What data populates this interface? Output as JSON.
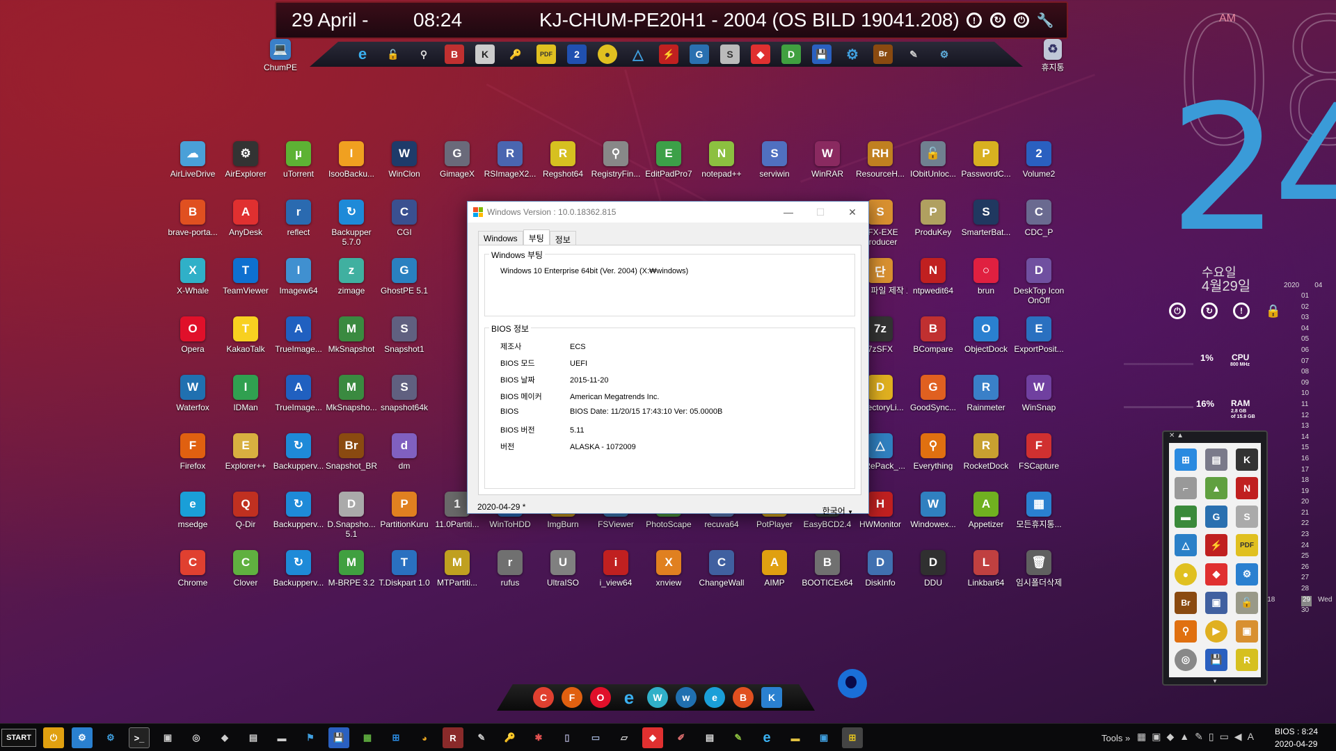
{
  "topbar": {
    "date": "29 April -",
    "time": "08:24",
    "title": "KJ-CHUM-PE20H1 - 2004 (OS BILD 19041.208)"
  },
  "desktop_top": {
    "chumpe": "ChumPE",
    "trash": "휴지통"
  },
  "desktop_icons": [
    {
      "label": "AirLiveDrive",
      "color": "#4aa0d8",
      "glyph": "☁"
    },
    {
      "label": "AirExplorer",
      "color": "#333",
      "glyph": "⚙"
    },
    {
      "label": "uTorrent",
      "color": "#5db234",
      "glyph": "µ"
    },
    {
      "label": "IsooBacku...",
      "color": "#f0a020",
      "glyph": "I"
    },
    {
      "label": "WinClon",
      "color": "#1e3b6a",
      "glyph": "W"
    },
    {
      "label": "GimageX",
      "color": "#6a6a7a",
      "glyph": "G"
    },
    {
      "label": "RSImageX2...",
      "color": "#4a66b0",
      "glyph": "R"
    },
    {
      "label": "Regshot64",
      "color": "#d6c020",
      "glyph": "R"
    },
    {
      "label": "RegistryFin...",
      "color": "#888",
      "glyph": "⚲"
    },
    {
      "label": "EditPadPro7",
      "color": "#3ca048",
      "glyph": "E"
    },
    {
      "label": "notepad++",
      "color": "#8cc040",
      "glyph": "N"
    },
    {
      "label": "serviwin",
      "color": "#5070c0",
      "glyph": "S"
    },
    {
      "label": "WinRAR",
      "color": "#8a2a60",
      "glyph": "W"
    },
    {
      "label": "ResourceH...",
      "color": "#c08020",
      "glyph": "RH"
    },
    {
      "label": "IObitUnloc...",
      "color": "#708090",
      "glyph": "🔓"
    },
    {
      "label": "PasswordC...",
      "color": "#d8b020",
      "glyph": "P"
    },
    {
      "label": "Volume2",
      "color": "#2a60c0",
      "glyph": "2"
    },
    {
      "label": "brave-porta...",
      "color": "#e05020",
      "glyph": "B"
    },
    {
      "label": "AnyDesk",
      "color": "#e03030",
      "glyph": "A"
    },
    {
      "label": "reflect",
      "color": "#2a6ab0",
      "glyph": "r"
    },
    {
      "label": "Backupper 5.7.0",
      "color": "#1e8ad8",
      "glyph": "↻"
    },
    {
      "label": "CGI",
      "color": "#3a5090",
      "glyph": "C"
    },
    {
      "label": "SFX-EXE Producer",
      "color": "#d89030",
      "glyph": "S"
    },
    {
      "label": "ProduKey",
      "color": "#b0a060",
      "glyph": "P"
    },
    {
      "label": "SmarterBat...",
      "color": "#203860",
      "glyph": "S"
    },
    {
      "label": "CDC_P",
      "color": "#6a6a90",
      "glyph": "C"
    },
    {
      "label": "X-Whale",
      "color": "#30b0c8",
      "glyph": "X"
    },
    {
      "label": "TeamViewer",
      "color": "#0e70d0",
      "glyph": "T"
    },
    {
      "label": "Imagew64",
      "color": "#4090d0",
      "glyph": "I"
    },
    {
      "label": "zimage",
      "color": "#40b0a0",
      "glyph": "z"
    },
    {
      "label": "GhostPE 5.1",
      "color": "#2a80c0",
      "glyph": "G"
    },
    {
      "label": "단일 파일 제작 도구",
      "color": "#d89030",
      "glyph": "단"
    },
    {
      "label": "ntpwedit64",
      "color": "#c02020",
      "glyph": "N"
    },
    {
      "label": "brun",
      "color": "#e02040",
      "glyph": "○"
    },
    {
      "label": "DeskTop Icon OnOff",
      "color": "#7050a0",
      "glyph": "D"
    },
    {
      "label": "Opera",
      "color": "#e0102a",
      "glyph": "O"
    },
    {
      "label": "KakaoTalk",
      "color": "#f8d020",
      "glyph": "T"
    },
    {
      "label": "TrueImage...",
      "color": "#2060c0",
      "glyph": "A"
    },
    {
      "label": "MkSnapshot",
      "color": "#3a8a40",
      "glyph": "M"
    },
    {
      "label": "Snapshot1",
      "color": "#606080",
      "glyph": "S"
    },
    {
      "label": "7zSFX",
      "color": "#333",
      "glyph": "7z"
    },
    {
      "label": "BCompare",
      "color": "#c03030",
      "glyph": "B"
    },
    {
      "label": "ObjectDock",
      "color": "#2a80d0",
      "glyph": "O"
    },
    {
      "label": "ExportPosit...",
      "color": "#2a70c0",
      "glyph": "E"
    },
    {
      "label": "Waterfox",
      "color": "#2070b0",
      "glyph": "W"
    },
    {
      "label": "IDMan",
      "color": "#30a050",
      "glyph": "I"
    },
    {
      "label": "TrueImage...",
      "color": "#2060c0",
      "glyph": "A"
    },
    {
      "label": "MkSnapsho...",
      "color": "#3a8a40",
      "glyph": "M"
    },
    {
      "label": "snapshot64k",
      "color": "#606080",
      "glyph": "S"
    },
    {
      "label": "DirectoryLi...",
      "color": "#e0b020",
      "glyph": "D"
    },
    {
      "label": "GoodSync...",
      "color": "#e06020",
      "glyph": "G"
    },
    {
      "label": "Rainmeter",
      "color": "#3a80c8",
      "glyph": "R"
    },
    {
      "label": "WinSnap",
      "color": "#7040a0",
      "glyph": "W"
    },
    {
      "label": "Firefox",
      "color": "#e06010",
      "glyph": "F"
    },
    {
      "label": "Explorer++",
      "color": "#d8b040",
      "glyph": "E"
    },
    {
      "label": "Backupperv...",
      "color": "#1e8ad8",
      "glyph": "↻"
    },
    {
      "label": "Snapshot_BR",
      "color": "#8a4a10",
      "glyph": "Br"
    },
    {
      "label": "dm",
      "color": "#8060c0",
      "glyph": "d"
    },
    {
      "label": "78RePack_...",
      "color": "#3080c0",
      "glyph": "△"
    },
    {
      "label": "Everything",
      "color": "#e07010",
      "glyph": "⚲"
    },
    {
      "label": "RocketDock",
      "color": "#c8a030",
      "glyph": "R"
    },
    {
      "label": "FSCapture",
      "color": "#d03030",
      "glyph": "F"
    },
    {
      "label": "msedge",
      "color": "#1a9fd8",
      "glyph": "e"
    },
    {
      "label": "Q-Dir",
      "color": "#c03020",
      "glyph": "Q"
    },
    {
      "label": "Backupperv...",
      "color": "#1e8ad8",
      "glyph": "↻"
    },
    {
      "label": "D.Snapsho... 5.1",
      "color": "#aaa",
      "glyph": "D"
    },
    {
      "label": "PartitionKuru",
      "color": "#e08020",
      "glyph": "P"
    },
    {
      "label": "11.0Partiti...",
      "color": "#6a6a6a",
      "glyph": "1"
    },
    {
      "label": "WinToHDD",
      "color": "#2a70c0",
      "glyph": "W"
    },
    {
      "label": "ImgBurn",
      "color": "#d0a020",
      "glyph": "I"
    },
    {
      "label": "FSViewer",
      "color": "#4080c0",
      "glyph": "F"
    },
    {
      "label": "PhotoScape",
      "color": "#50a040",
      "glyph": "P"
    },
    {
      "label": "recuva64",
      "color": "#6080c0",
      "glyph": "r"
    },
    {
      "label": "PotPlayer",
      "color": "#e0b020",
      "glyph": "▶"
    },
    {
      "label": "EasyBCD2.4",
      "color": "#404040",
      "glyph": "E"
    },
    {
      "label": "HWMonitor",
      "color": "#c02020",
      "glyph": "H"
    },
    {
      "label": "Windowex...",
      "color": "#3080c0",
      "glyph": "W"
    },
    {
      "label": "Appetizer",
      "color": "#70b020",
      "glyph": "A"
    },
    {
      "label": "모든휴지통...",
      "color": "#2a80d0",
      "glyph": "▦"
    },
    {
      "label": "Chrome",
      "color": "#e04030",
      "glyph": "C"
    },
    {
      "label": "Clover",
      "color": "#60b040",
      "glyph": "C"
    },
    {
      "label": "Backupperv...",
      "color": "#1e8ad8",
      "glyph": "↻"
    },
    {
      "label": "M-BRPE 3.2",
      "color": "#40a040",
      "glyph": "M"
    },
    {
      "label": "T.Diskpart 1.0",
      "color": "#2a70c0",
      "glyph": "T"
    },
    {
      "label": "MTPartiti...",
      "color": "#c0a020",
      "glyph": "M"
    },
    {
      "label": "rufus",
      "color": "#707070",
      "glyph": "r"
    },
    {
      "label": "UltraISO",
      "color": "#808080",
      "glyph": "U"
    },
    {
      "label": "i_view64",
      "color": "#c02020",
      "glyph": "i"
    },
    {
      "label": "xnview",
      "color": "#e08020",
      "glyph": "X"
    },
    {
      "label": "ChangeWall",
      "color": "#4060a0",
      "glyph": "C"
    },
    {
      "label": "AIMP",
      "color": "#e0a010",
      "glyph": "A"
    },
    {
      "label": "BOOTICEx64",
      "color": "#707070",
      "glyph": "B"
    },
    {
      "label": "DiskInfo",
      "color": "#4070b0",
      "glyph": "D"
    },
    {
      "label": "DDU",
      "color": "#303030",
      "glyph": "D"
    },
    {
      "label": "Linkbar64",
      "color": "#c04040",
      "glyph": "L"
    },
    {
      "label": "임시폴더삭제",
      "color": "#606060",
      "glyph": "🗑"
    }
  ],
  "dialog": {
    "title": "Windows Version : 10.0.18362.815",
    "tabs": [
      "Windows",
      "부팅",
      "정보"
    ],
    "boot_group_title": "Windows 부팅",
    "boot_text": "Windows 10 Enterprise 64bit (Ver. 2004) (X:₩windows)",
    "bios_group_title": "BIOS 정보",
    "bios_rows": [
      {
        "k": "제조사",
        "v": "ECS"
      },
      {
        "k": "BIOS 모드",
        "v": "UEFI"
      },
      {
        "k": "BIOS 날짜",
        "v": "2015-11-20"
      },
      {
        "k": "BIOS 메이커",
        "v": "American Megatrends Inc."
      },
      {
        "k": "BIOS",
        "v": "BIOS Date: 11/20/15 17:43:10 Ver: 05.0000B"
      },
      {
        "k": "BIOS 버전",
        "v": "5.11"
      },
      {
        "k": "버전",
        "v": "ALASKA - 1072009"
      }
    ],
    "status_date": "2020-04-29 *",
    "language": "한국어"
  },
  "clock": {
    "ampm": "AM",
    "hours": "08",
    "minutes": "24",
    "weekday": "수요일",
    "date_kr": "4월29일"
  },
  "calendar": {
    "year": "2020",
    "month": "04",
    "days": [
      "01",
      "02",
      "03",
      "04",
      "05",
      "06",
      "07",
      "08",
      "09",
      "10",
      "11",
      "12",
      "13",
      "14",
      "15",
      "16",
      "17",
      "18",
      "19",
      "20",
      "21",
      "22",
      "23",
      "24",
      "25",
      "26",
      "27",
      "28",
      "29",
      "30"
    ],
    "week": "w18",
    "weekday_short": "Wed"
  },
  "meters": {
    "cpu_pct": "1%",
    "cpu_label": "CPU",
    "cpu_sub": "800 MHz",
    "ram_pct": "16%",
    "ram_label": "RAM",
    "ram_sub1": "2.8 GB",
    "ram_sub2": "of 15.9 GB"
  },
  "taskbar": {
    "start": "START",
    "tools": "Tools",
    "clock_line1": "BIOS : 8:24",
    "clock_line2": "2020-04-29"
  },
  "colors": {
    "accent_blue": "#3a9bd8",
    "topbar_border": "#7a1a24"
  }
}
